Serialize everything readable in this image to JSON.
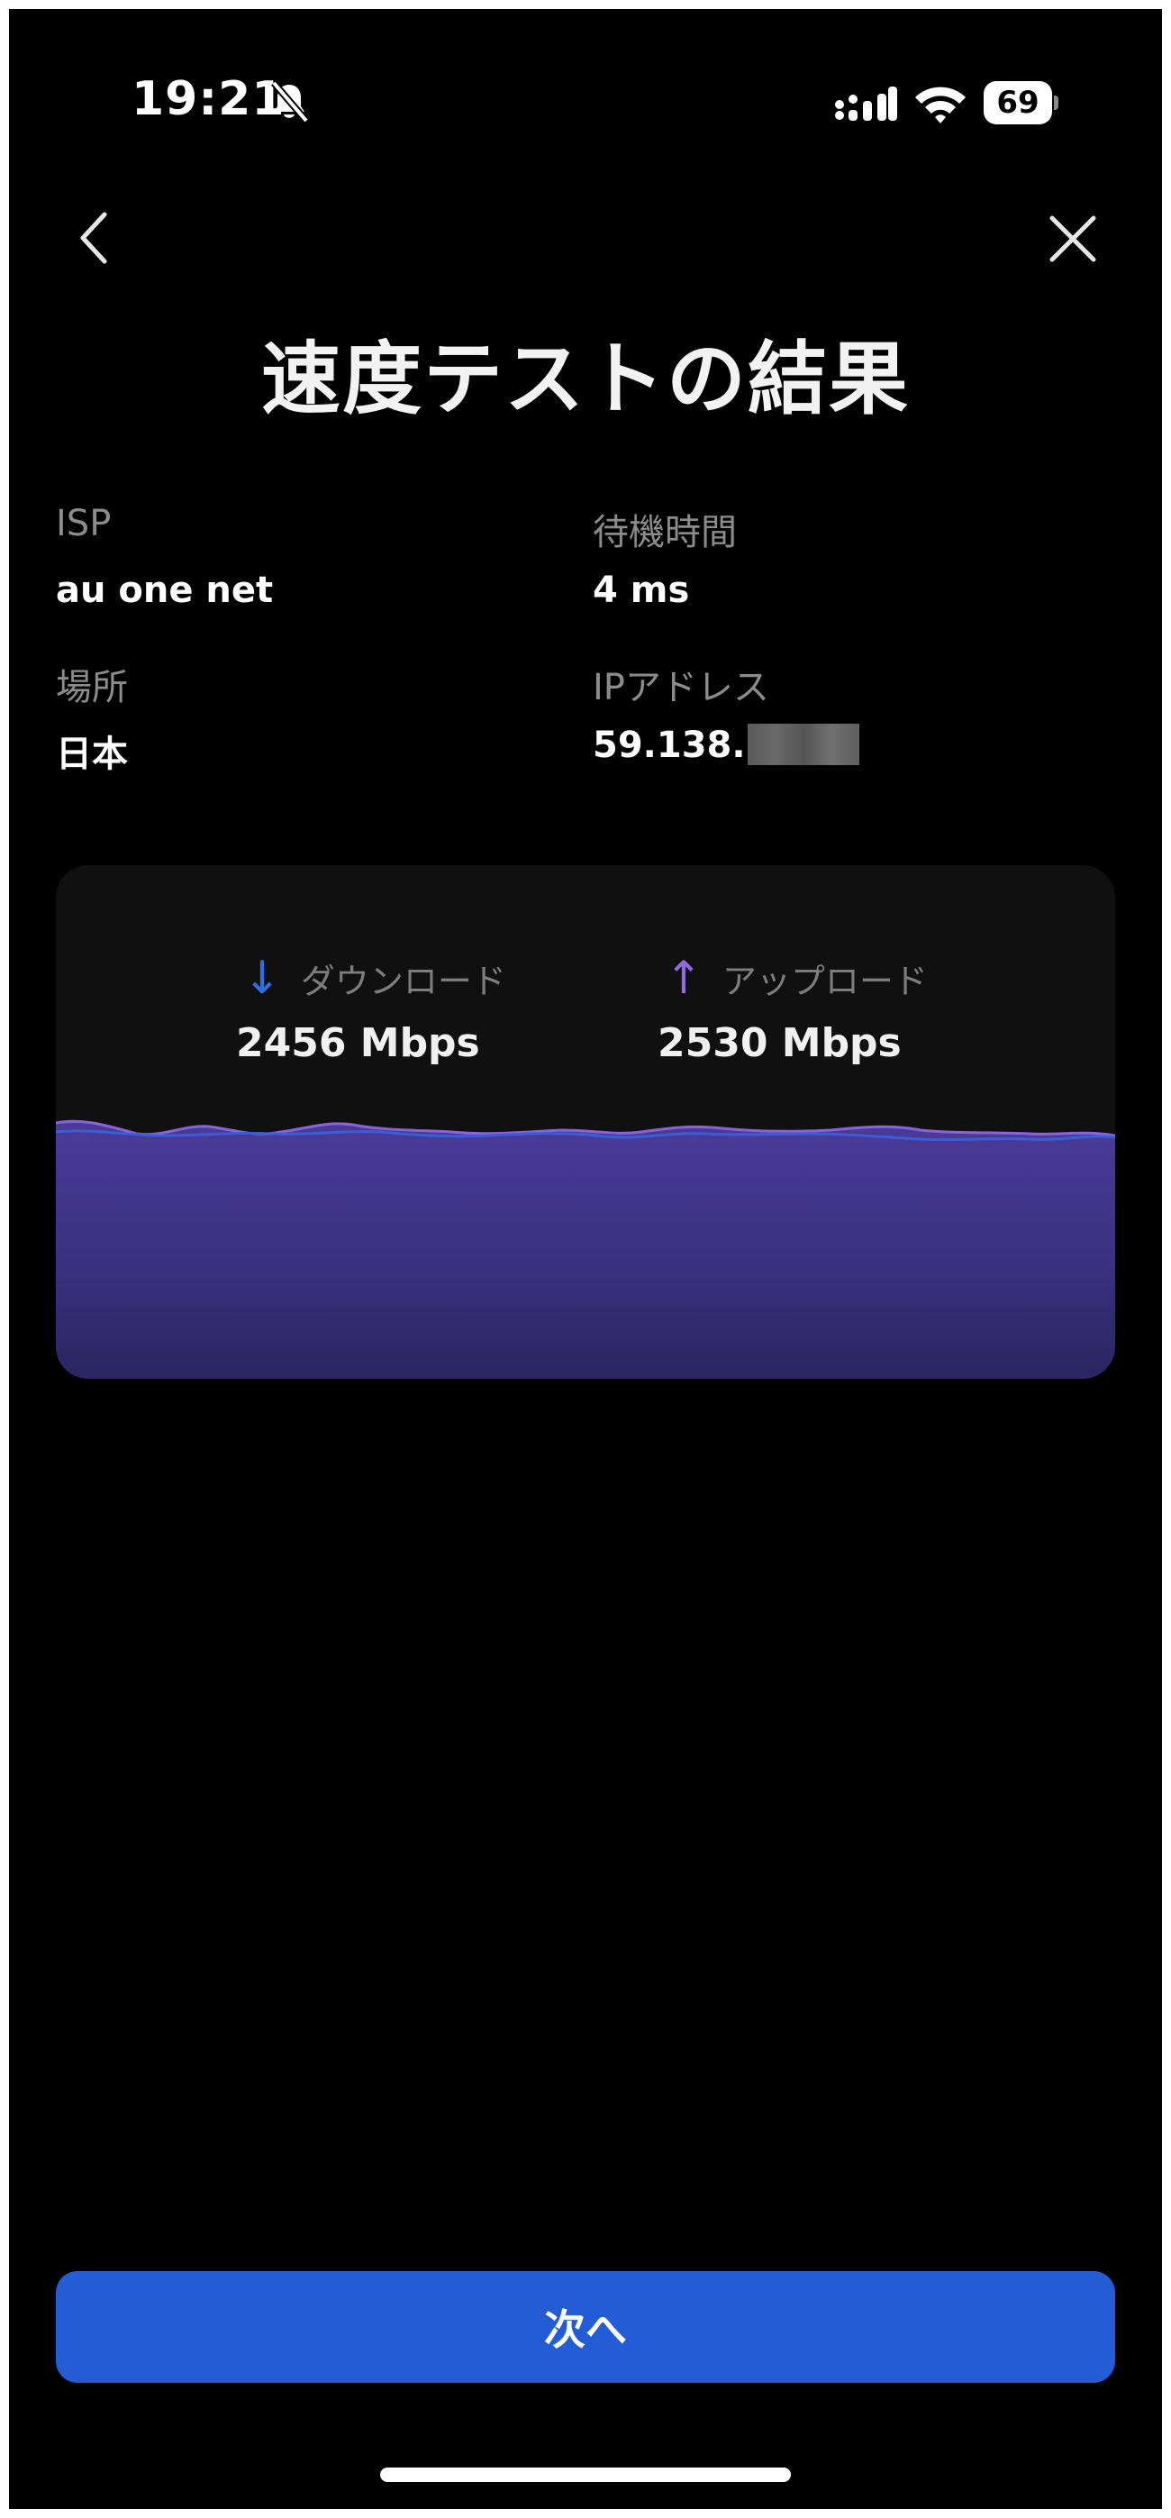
{
  "status_bar": {
    "time": "19:21",
    "battery_level": "69",
    "icons": [
      "bell-slash-icon",
      "signal-icon",
      "wifi-icon",
      "battery-icon"
    ]
  },
  "nav": {
    "back_icon": "chevron-left-icon",
    "close_icon": "close-icon"
  },
  "page": {
    "title": "速度テストの結果"
  },
  "info": {
    "isp_label": "ISP",
    "isp_value": "au one net",
    "latency_label": "待機時間",
    "latency_value": "4 ms",
    "location_label": "場所",
    "location_value": "日本",
    "ip_label": "IPアドレス",
    "ip_value_visible": "59.138."
  },
  "results": {
    "download_arrow": "↓",
    "download_label": "ダウンロード",
    "download_value": "2456 Mbps",
    "upload_arrow": "↑",
    "upload_label": "アップロード",
    "upload_value": "2530 Mbps"
  },
  "colors": {
    "accent_blue": "#245cd6",
    "download_color": "#2f6fe6",
    "upload_color": "#8f6ae0",
    "background": "#000000"
  },
  "footer": {
    "next_label": "次へ"
  }
}
